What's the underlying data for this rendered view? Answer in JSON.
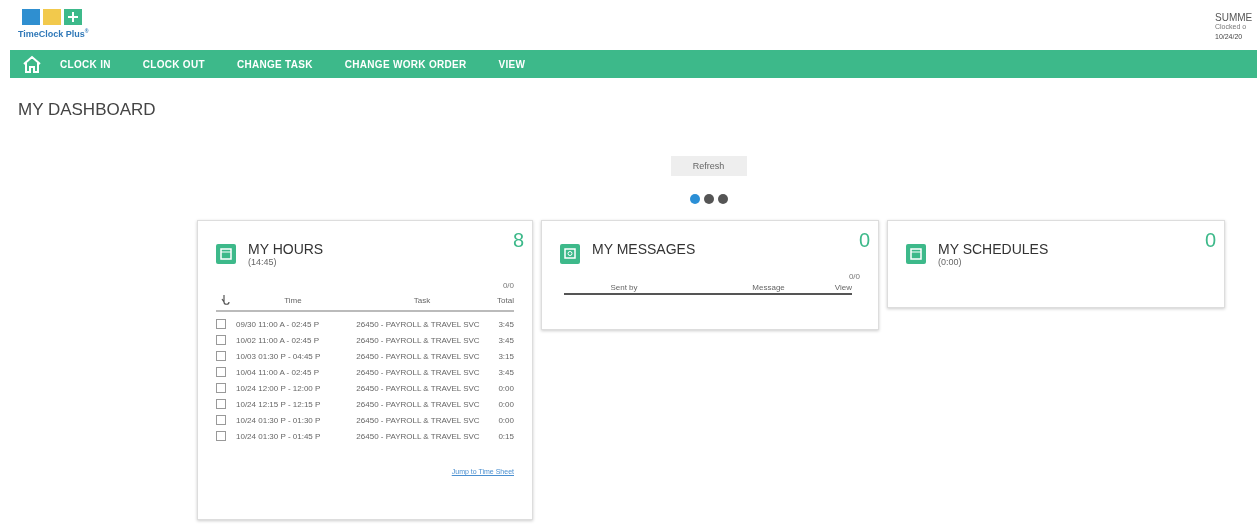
{
  "logo": {
    "text": "TimeClock Plus",
    "mark": "®"
  },
  "user": {
    "name": "SUMME",
    "status": "Clocked o",
    "date": "10/24/20"
  },
  "nav": [
    "CLOCK IN",
    "CLOCK OUT",
    "CHANGE TASK",
    "CHANGE WORK ORDER",
    "VIEW"
  ],
  "page_title": "MY DASHBOARD",
  "refresh_button": "Refresh",
  "carousel_dots": [
    {
      "selected": true
    },
    {
      "selected": false
    },
    {
      "selected": false
    }
  ],
  "hours": {
    "title": "MY HOURS",
    "subtitle": "(14:45)",
    "count": "8",
    "paging": "0/0",
    "columns": [
      "Time",
      "Task",
      "Total"
    ],
    "rows": [
      {
        "checked": false,
        "time": "09/30 11:00 A - 02:45 P",
        "task": "26450 - PAYROLL & TRAVEL SVC",
        "total": "3:45"
      },
      {
        "checked": false,
        "time": "10/02 11:00 A - 02:45 P",
        "task": "26450 - PAYROLL & TRAVEL SVC",
        "total": "3:45"
      },
      {
        "checked": false,
        "time": "10/03 01:30 P - 04:45 P",
        "task": "26450 - PAYROLL & TRAVEL SVC",
        "total": "3:15"
      },
      {
        "checked": false,
        "time": "10/04 11:00 A - 02:45 P",
        "task": "26450 - PAYROLL & TRAVEL SVC",
        "total": "3:45"
      },
      {
        "checked": false,
        "time": "10/24 12:00 P - 12:00 P",
        "task": "26450 - PAYROLL & TRAVEL SVC",
        "total": "0:00"
      },
      {
        "checked": false,
        "time": "10/24 12:15 P - 12:15 P",
        "task": "26450 - PAYROLL & TRAVEL SVC",
        "total": "0:00"
      },
      {
        "checked": false,
        "time": "10/24 01:30 P - 01:30 P",
        "task": "26450 - PAYROLL & TRAVEL SVC",
        "total": "0:00"
      },
      {
        "checked": false,
        "time": "10/24 01:30 P - 01:45 P",
        "task": "26450 - PAYROLL & TRAVEL SVC",
        "total": "0:15"
      }
    ],
    "link": "Jump to Time Sheet"
  },
  "messages": {
    "title": "MY MESSAGES",
    "count": "0",
    "paging": "0/0",
    "columns": [
      "Sent by",
      "Message",
      "View"
    ]
  },
  "schedules": {
    "title": "MY SCHEDULES",
    "subtitle": "(0:00)",
    "count": "0"
  }
}
